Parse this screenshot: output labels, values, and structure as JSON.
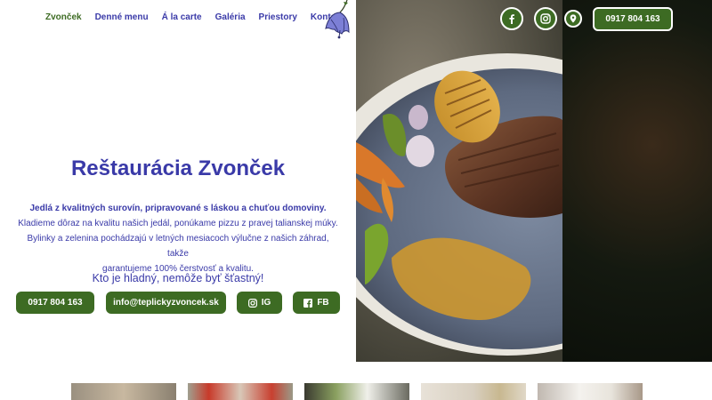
{
  "nav": {
    "links": [
      "Zvonček",
      "Denné menu",
      "Á la carte",
      "Galéria",
      "Priestory",
      "Kontakt"
    ]
  },
  "hero": {
    "title": "Reštaurácia Zvonček",
    "intro_bold": "Jedlá z kvalitných surovín, pripravované s láskou a chuťou domoviny.",
    "line2": "Kladieme dôraz na kvalitu našich jedál,  ponúkame pizzu z pravej talianskej múky.",
    "line3": "Bylinky a zelenina pochádzajú v letných mesiacoch výlučne z našich záhrad, takže",
    "line4": "garantujeme 100% čerstvosť  a kvalitu.",
    "slogan": "Kto je hladný, nemôže byť šťastný!"
  },
  "buttons": {
    "phone": "0917 804 163",
    "email": "info@teplickyzvoncek.sk",
    "ig": "IG",
    "fb": "FB"
  },
  "header_right": {
    "phone": "0917 804 163",
    "icons": [
      "facebook-icon",
      "instagram-icon",
      "location-pin-icon"
    ]
  },
  "colors": {
    "brand_green": "#3d6b23",
    "brand_blue": "#3a3aa8",
    "white": "#ffffff"
  }
}
